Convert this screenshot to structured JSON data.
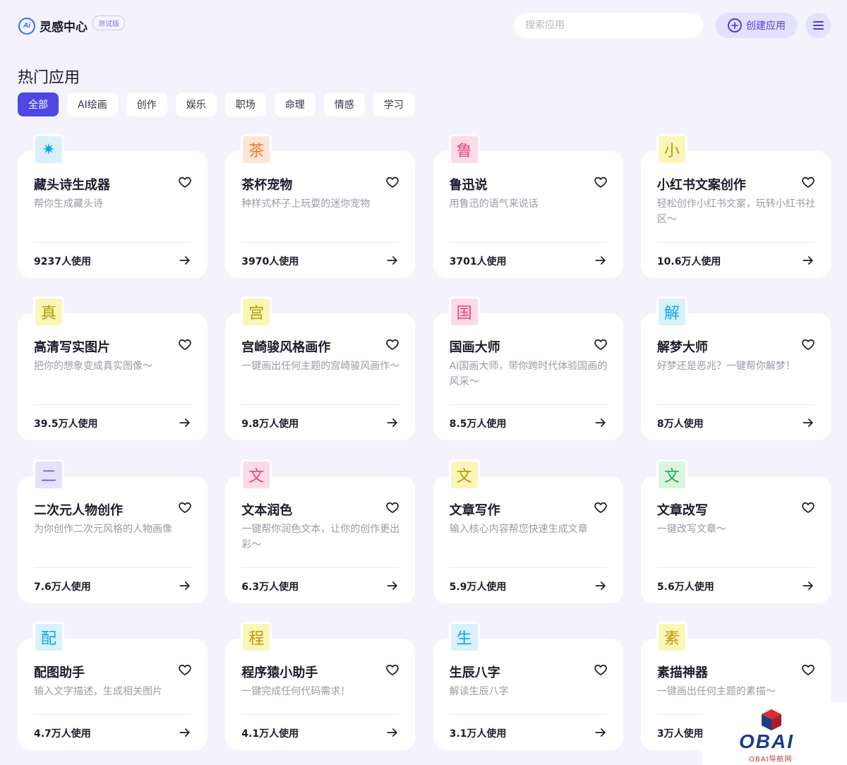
{
  "header": {
    "logo_mark": "Ai",
    "title": "灵感中心",
    "badge": "测试版",
    "search_placeholder": "搜索应用",
    "create_label": "创建应用"
  },
  "section_title": "热门应用",
  "filters": [
    "全部",
    "AI绘画",
    "创作",
    "娱乐",
    "职场",
    "命理",
    "情感",
    "学习"
  ],
  "active_filter": "全部",
  "cards": [
    {
      "icon": "✷",
      "icon_name": "starburst-icon",
      "icon_color": "#0ea5e9",
      "icon_bg": "#d8f1fb",
      "title": "藏头诗生成器",
      "desc": "帮你生成藏头诗",
      "usage": "9237人使用"
    },
    {
      "icon": "茶",
      "icon_name": "tea-char-icon",
      "icon_color": "#ea7a28",
      "icon_bg": "#fde6d4",
      "title": "茶杯宠物",
      "desc": "种样式杯子上玩耍的迷你宠物",
      "usage": "3970人使用"
    },
    {
      "icon": "鲁",
      "icon_name": "lu-char-icon",
      "icon_color": "#e0457b",
      "icon_bg": "#fcdbe7",
      "title": "鲁迅说",
      "desc": "用鲁迅的语气来说话",
      "usage": "3701人使用"
    },
    {
      "icon": "小",
      "icon_name": "xiao-char-icon",
      "icon_color": "#b59a00",
      "icon_bg": "#fbf6b8",
      "title": "小红书文案创作",
      "desc": "轻松创作小红书文案，玩转小红书社区～",
      "usage": "10.6万人使用"
    },
    {
      "icon": "真",
      "icon_name": "zhen-char-icon",
      "icon_color": "#b59a00",
      "icon_bg": "#fbf6b8",
      "title": "高清写实图片",
      "desc": "把你的想象变成真实图像～",
      "usage": "39.5万人使用"
    },
    {
      "icon": "宫",
      "icon_name": "gong-char-icon",
      "icon_color": "#b59a00",
      "icon_bg": "#fbf6b8",
      "title": "宫崎骏风格画作",
      "desc": "一键画出任何主题的宫崎骏风画作～",
      "usage": "9.8万人使用"
    },
    {
      "icon": "国",
      "icon_name": "guo-char-icon",
      "icon_color": "#e0457b",
      "icon_bg": "#fcdbe7",
      "title": "国画大师",
      "desc": "AI国画大师，带你跨时代体验国画的风采～",
      "usage": "8.5万人使用"
    },
    {
      "icon": "解",
      "icon_name": "jie-char-icon",
      "icon_color": "#0ea5e9",
      "icon_bg": "#d8f1fb",
      "title": "解梦大师",
      "desc": "好梦还是恶兆？一键帮你解梦！",
      "usage": "8万人使用"
    },
    {
      "icon": "二",
      "icon_name": "er-char-icon",
      "icon_color": "#6d5ce8",
      "icon_bg": "#e6e2fb",
      "title": "二次元人物创作",
      "desc": "为你创作二次元风格的人物画像",
      "usage": "7.6万人使用"
    },
    {
      "icon": "文",
      "icon_name": "wen-char-icon",
      "icon_color": "#e0457b",
      "icon_bg": "#fcdbe7",
      "title": "文本润色",
      "desc": "一键帮你润色文本，让你的创作更出彩～",
      "usage": "6.3万人使用"
    },
    {
      "icon": "文",
      "icon_name": "wen-char-icon",
      "icon_color": "#b59a00",
      "icon_bg": "#fbf6b8",
      "title": "文章写作",
      "desc": "输入核心内容帮您快速生成文章",
      "usage": "5.9万人使用"
    },
    {
      "icon": "文",
      "icon_name": "wen-char-icon",
      "icon_color": "#2ea84f",
      "icon_bg": "#daf5df",
      "title": "文章改写",
      "desc": "一键改写文章～",
      "usage": "5.6万人使用"
    },
    {
      "icon": "配",
      "icon_name": "pei-char-icon",
      "icon_color": "#0ea5e9",
      "icon_bg": "#d8f1fb",
      "title": "配图助手",
      "desc": "输入文字描述，生成相关图片",
      "usage": "4.7万人使用"
    },
    {
      "icon": "程",
      "icon_name": "cheng-char-icon",
      "icon_color": "#b59a00",
      "icon_bg": "#fbf6b8",
      "title": "程序猿小助手",
      "desc": "一键完成任何代码需求！",
      "usage": "4.1万人使用"
    },
    {
      "icon": "生",
      "icon_name": "sheng-char-icon",
      "icon_color": "#0ea5e9",
      "icon_bg": "#d8f1fb",
      "title": "生辰八字",
      "desc": "解读生辰八字",
      "usage": "3.1万人使用"
    },
    {
      "icon": "素",
      "icon_name": "su-char-icon",
      "icon_color": "#b59a00",
      "icon_bg": "#fbf6b8",
      "title": "素描神器",
      "desc": "一键画出任何主题的素描～",
      "usage": "3万人使用"
    }
  ],
  "watermark": {
    "text": "OBAI",
    "sub": "OBAI导航网"
  }
}
